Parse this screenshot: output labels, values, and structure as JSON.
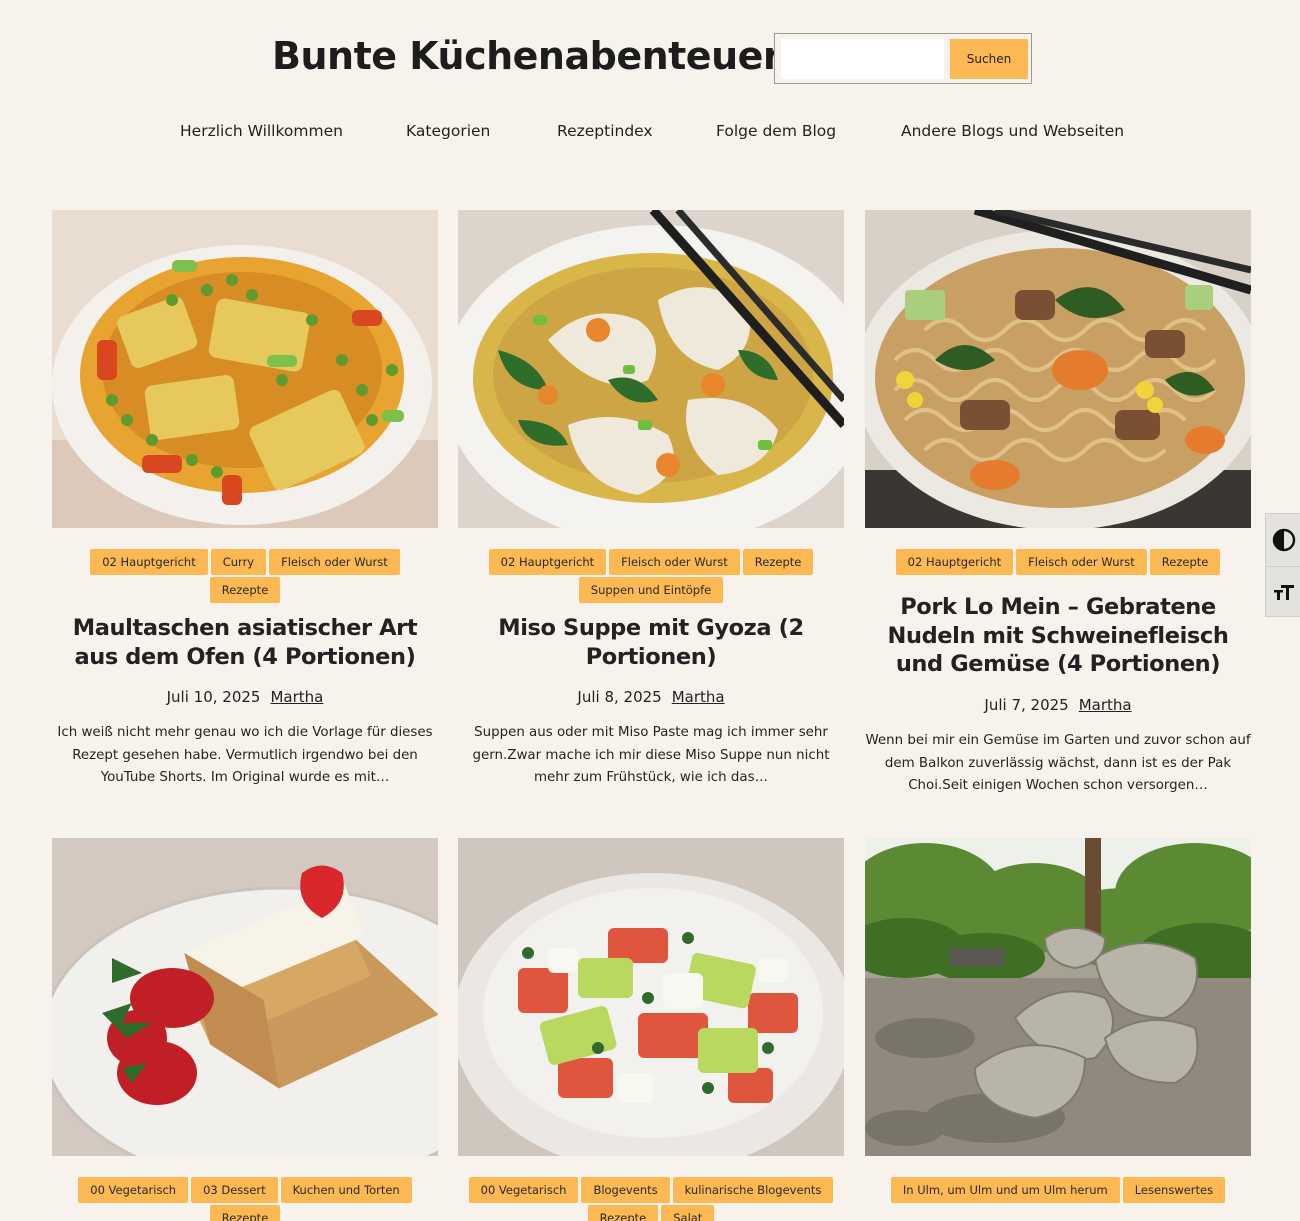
{
  "header": {
    "site_title": "Bunte Küchenabenteuer",
    "search_placeholder": "",
    "search_button": "Suchen"
  },
  "nav": {
    "items": [
      {
        "label": "Herzlich Willkommen"
      },
      {
        "label": "Kategorien"
      },
      {
        "label": "Rezeptindex"
      },
      {
        "label": "Folge dem Blog"
      },
      {
        "label": "Andere Blogs und Webseiten"
      }
    ]
  },
  "accessibility_tools": {
    "contrast_icon": "contrast-icon",
    "text_size_icon": "text-size-icon"
  },
  "posts": [
    {
      "tags": [
        "02 Hauptgericht",
        "Curry",
        "Fleisch oder Wurst",
        "Rezepte"
      ],
      "title": "Maultaschen asiatischer Art aus dem Ofen (4 Portionen)",
      "date": "Juli 10, 2025",
      "author": "Martha",
      "excerpt": "Ich weiß nicht mehr genau wo ich die Vorlage für dieses Rezept gesehen habe. Vermutlich irgendwo bei den YouTube Shorts. Im Original wurde es mit…"
    },
    {
      "tags": [
        "02 Hauptgericht",
        "Fleisch oder Wurst",
        "Rezepte",
        "Suppen und Eintöpfe"
      ],
      "title": "Miso Suppe mit Gyoza (2 Portionen)",
      "date": "Juli 8, 2025",
      "author": "Martha",
      "excerpt": "Suppen aus oder mit Miso Paste mag ich immer sehr gern.Zwar mache ich mir diese Miso Suppe nun nicht mehr zum Frühstück, wie ich das…"
    },
    {
      "tags": [
        "02 Hauptgericht",
        "Fleisch oder Wurst",
        "Rezepte"
      ],
      "title": "Pork Lo Mein – Gebratene Nudeln mit Schweinefleisch und Gemüse (4 Portionen)",
      "date": "Juli 7, 2025",
      "author": "Martha",
      "excerpt": "Wenn bei mir ein Gemüse im Garten und zuvor schon auf dem Balkon zuverlässig wächst, dann ist es der Pak Choi.Seit einigen Wochen schon versorgen…"
    },
    {
      "tags": [
        "00 Vegetarisch",
        "03 Dessert",
        "Kuchen und Torten",
        "Rezepte"
      ]
    },
    {
      "tags": [
        "00 Vegetarisch",
        "Blogevents",
        "kulinarische Blogevents",
        "Rezepte",
        "Salat"
      ]
    },
    {
      "tags": [
        "In Ulm, um Ulm und um Ulm herum",
        "Lesenswertes"
      ]
    }
  ]
}
